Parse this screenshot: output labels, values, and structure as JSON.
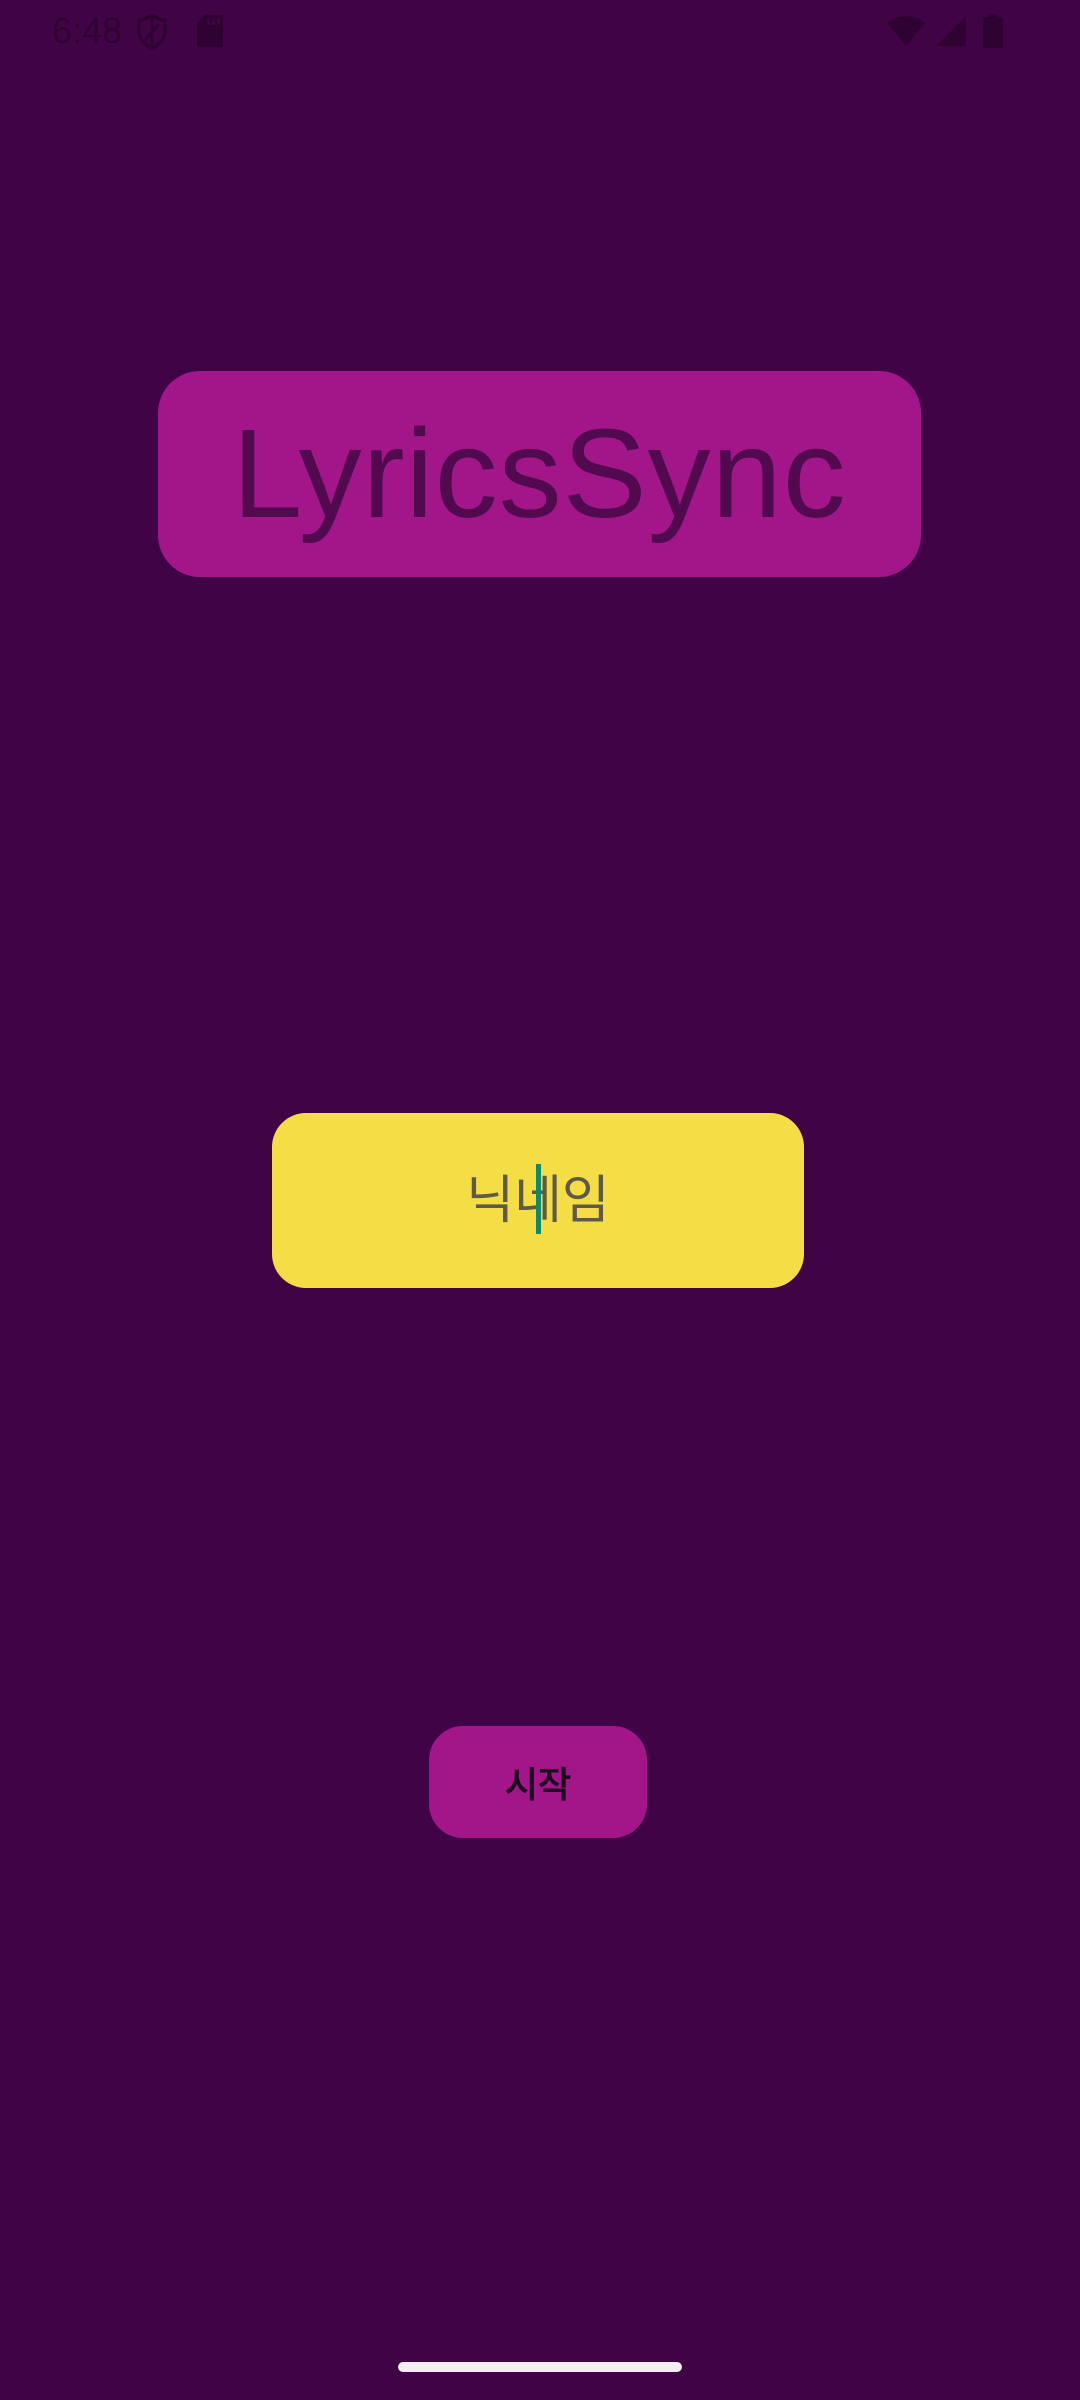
{
  "status_bar": {
    "time": "6:48",
    "icons": [
      "shield-icon",
      "sd-card-icon",
      "wifi-icon",
      "signal-icon",
      "battery-icon"
    ]
  },
  "app": {
    "title": "LyricsSync"
  },
  "nickname": {
    "placeholder": "닉네임",
    "value": ""
  },
  "start_button": {
    "label": "시작"
  },
  "colors": {
    "background": "#400446",
    "title_card": "#a3168a",
    "title_text": "#520a4e",
    "input_background": "#f4dd45",
    "caret": "#0d8a6a",
    "button": "#a3168a",
    "status_icons": "#2e0332"
  }
}
